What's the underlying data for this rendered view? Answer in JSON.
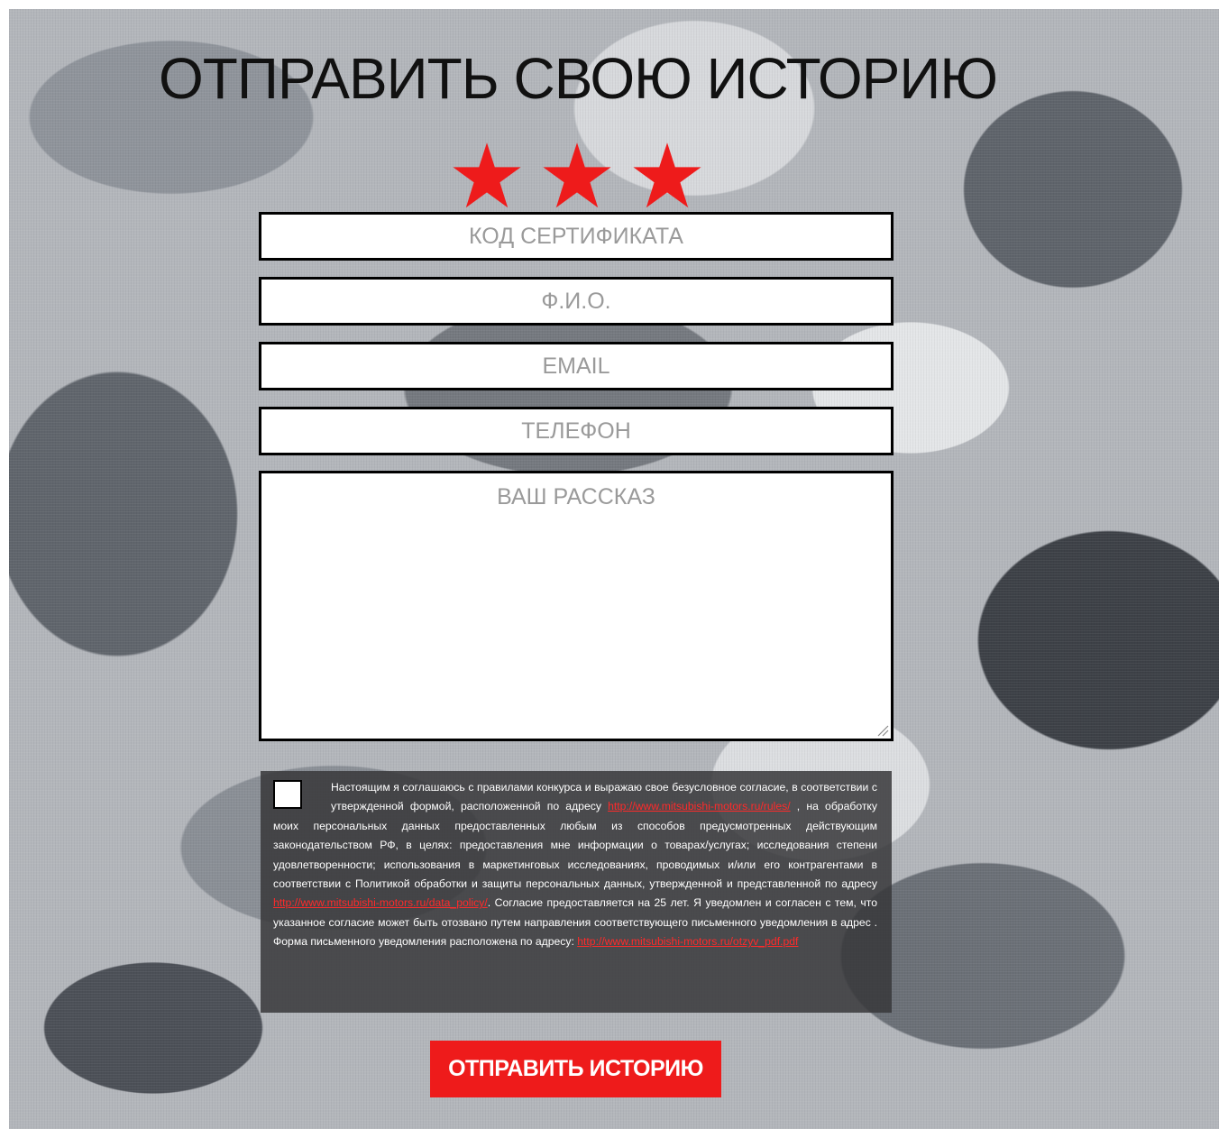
{
  "page": {
    "title": "ОТПРАВИТЬ СВОЮ ИСТОРИЮ",
    "star_color": "#ee1b1b"
  },
  "form": {
    "certificate_placeholder": "КОД СЕРТИФИКАТА",
    "name_placeholder": "Ф.И.О.",
    "email_placeholder": "EMAIL",
    "phone_placeholder": "ТЕЛЕФОН",
    "story_placeholder": "ВАШ РАССКАЗ",
    "submit_label": "ОТПРАВИТЬ ИСТОРИЮ"
  },
  "consent": {
    "checked": false,
    "text_1": "Настоящим я соглашаюсь с правилами конкурса и выражаю свое безусловное согласие, в соответствии с утвержденной формой, расположенной по адресу ",
    "link_1": "http://www.mitsubishi-motors.ru/rules/",
    "text_2": " , на обработку моих персональных данных предоставленных любым из способов предусмотренных действующим законодательством РФ, в целях: предоставления мне информации о товарах/услугах; исследования степени удовлетворенности; использования в маркетинговых исследованиях, проводимых и/или его контрагентами в соответствии с Политикой обработки и защиты персональных данных, утвержденной и представленной по адресу ",
    "link_2": "http://www.mitsubishi-motors.ru/data_policy/",
    "text_3": ". Согласие предоставляется на 25 лет. Я уведомлен и согласен с тем, что указанное согласие может быть отозвано путем направления соответствующего письменного уведомления в адрес . Форма письменного уведомления расположена по адресу: ",
    "link_3": "http://www.mitsubishi-motors.ru/otzyv_pdf.pdf"
  }
}
